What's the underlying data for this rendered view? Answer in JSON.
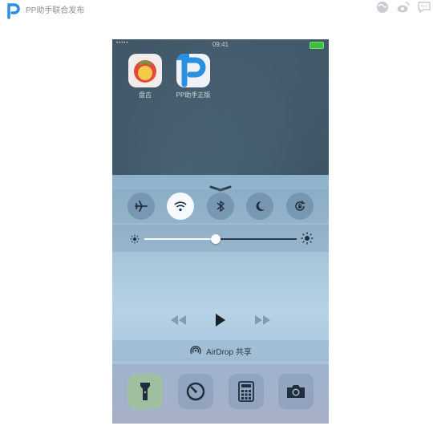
{
  "header": {
    "title": "PP助手联合发布",
    "icons": [
      "globe-icon",
      "weibo-icon",
      "chat-icon"
    ]
  },
  "status_bar": {
    "signal": "•••••",
    "time": "09:41"
  },
  "home_apps": [
    {
      "label": "盘古",
      "icon": "pangu-icon"
    },
    {
      "label": "PP助手正版",
      "icon": "pp-assistant-icon"
    }
  ],
  "control_center": {
    "toggles": [
      {
        "name": "airplane-mode",
        "icon": "airplane-icon",
        "on": false
      },
      {
        "name": "wifi",
        "icon": "wifi-icon",
        "on": true
      },
      {
        "name": "bluetooth",
        "icon": "bluetooth-icon",
        "on": false
      },
      {
        "name": "do-not-disturb",
        "icon": "moon-icon",
        "on": false
      },
      {
        "name": "rotation-lock",
        "icon": "rotation-lock-icon",
        "on": false
      }
    ],
    "brightness_level": 0.47,
    "airdrop_label": "AirDrop 共享",
    "quick_actions": [
      {
        "name": "flashlight",
        "icon": "flashlight-icon",
        "on": true
      },
      {
        "name": "timer",
        "icon": "timer-icon",
        "on": false
      },
      {
        "name": "calculator",
        "icon": "calculator-icon",
        "on": false
      },
      {
        "name": "camera",
        "icon": "camera-icon",
        "on": false
      }
    ]
  },
  "colors": {
    "brand_blue": "#2a8fe0",
    "toggle_on": "#f6fafd",
    "flashlight_on": "#9fbfa0"
  }
}
